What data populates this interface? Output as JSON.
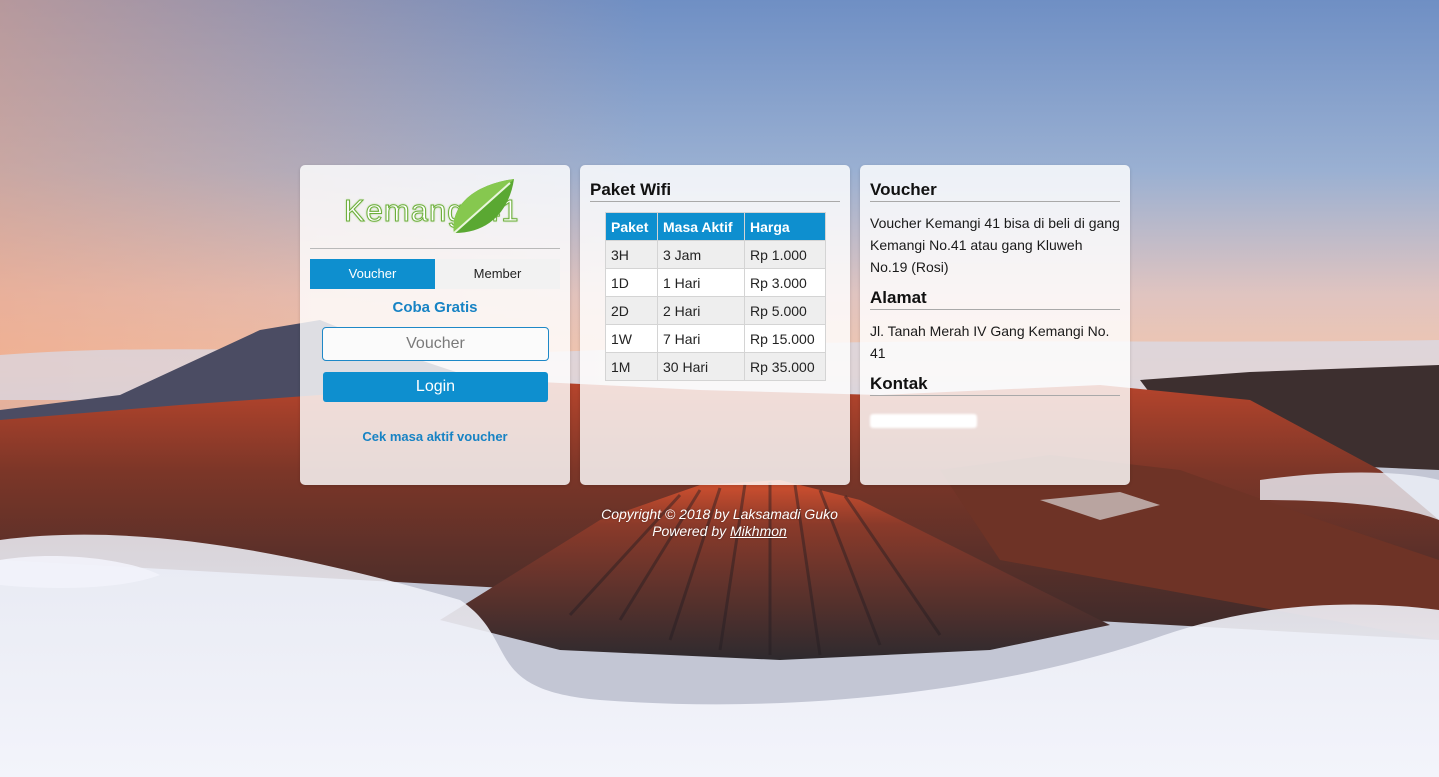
{
  "logo": {
    "text": "Kemangi 41"
  },
  "login": {
    "tabs": [
      {
        "label": "Voucher",
        "active": true
      },
      {
        "label": "Member",
        "active": false
      }
    ],
    "trial_link": "Coba Gratis",
    "voucher_placeholder": "Voucher",
    "voucher_value": "",
    "login_button": "Login",
    "check_link": "Cek masa aktif voucher"
  },
  "packages": {
    "title": "Paket Wifi",
    "headers": [
      "Paket",
      "Masa Aktif",
      "Harga"
    ],
    "rows": [
      [
        "3H",
        "3 Jam",
        "Rp 1.000"
      ],
      [
        "1D",
        "1 Hari",
        "Rp 3.000"
      ],
      [
        "2D",
        "2 Hari",
        "Rp 5.000"
      ],
      [
        "1W",
        "7 Hari",
        "Rp 15.000"
      ],
      [
        "1M",
        "30 Hari",
        "Rp 35.000"
      ]
    ]
  },
  "info": {
    "voucher_title": "Voucher",
    "voucher_text": "Voucher Kemangi 41 bisa di beli di gang Kemangi No.41 atau gang Kluweh No.19 (Rosi)",
    "address_title": "Alamat",
    "address_text": "Jl. Tanah Merah IV Gang Kemangi No. 41",
    "contact_title": "Kontak"
  },
  "footer": {
    "copyright": "Copyright © 2018 by Laksamadi Guko",
    "powered_prefix": "Powered by",
    "powered_link": "Mikhmon"
  },
  "colors": {
    "accent": "#0e8fcf",
    "link": "#1783c4"
  }
}
